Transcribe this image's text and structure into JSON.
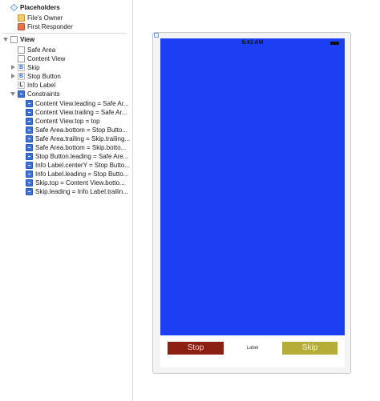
{
  "outline": {
    "placeholders_label": "Placeholders",
    "files_owner": "File's Owner",
    "first_responder": "First Responder",
    "view_label": "View",
    "safe_area": "Safe Area",
    "content_view": "Content View",
    "skip": "Skip",
    "stop_button": "Stop Button",
    "info_label": "Info Label",
    "constraints_label": "Constraints",
    "constraints": [
      "Content View.leading = Safe Ar...",
      "Content View.trailing = Safe Ar...",
      "Content View.top = top",
      "Safe Area.bottom = Stop Butto...",
      "Safe Area.trailing = Skip.trailing...",
      "Safe Area.bottom = Skip.botto...",
      "Stop Button.leading = Safe Are...",
      "Info Label.centerY = Stop Butto...",
      "Info Label.leading = Stop Butto...",
      "Skip.top = Content View.botto...",
      "Skip.leading = Info Label.trailin..."
    ],
    "letters": {
      "skip": "B",
      "stop": "B",
      "label": "L"
    }
  },
  "canvas": {
    "status_time": "9:41 AM",
    "stop_label": "Stop",
    "info_label_text": "Label",
    "skip_label": "Skip",
    "colors": {
      "content_view": "#1c3ff3",
      "stop_button": "#8b1f12",
      "skip_button": "#b5ad3a"
    }
  }
}
